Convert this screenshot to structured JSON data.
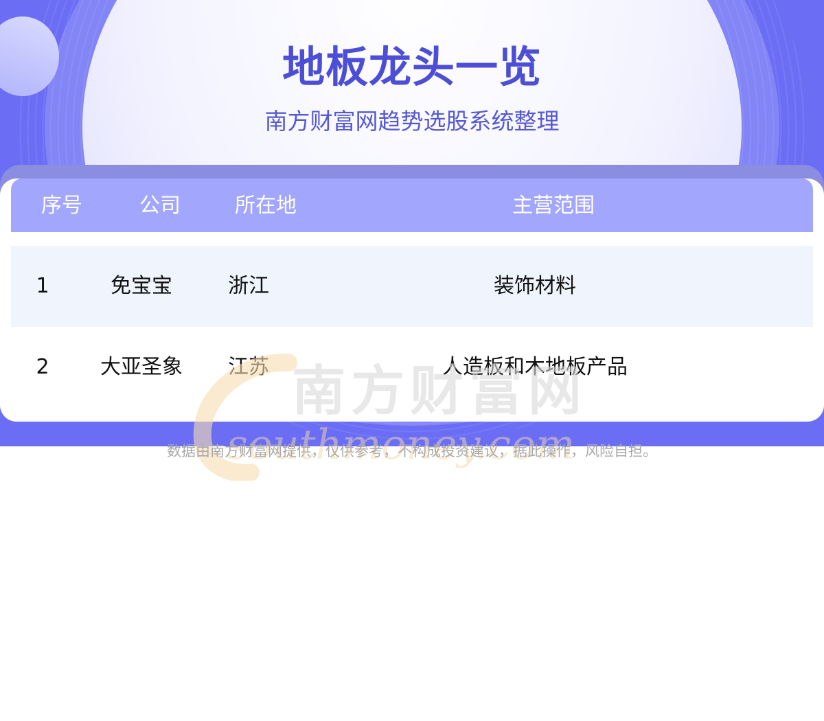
{
  "header": {
    "title": "地板龙头一览",
    "subtitle": "南方财富网趋势选股系统整理"
  },
  "table": {
    "columns": [
      "序号",
      "公司",
      "所在地",
      "主营范围"
    ],
    "rows": [
      [
        "1",
        "免宝宝",
        "浙江",
        "装饰材料"
      ],
      [
        "2",
        "大亚圣象",
        "江苏",
        "人造板和木地板产品"
      ]
    ]
  },
  "watermark": {
    "name": "南方财富网",
    "domain": "southmoney.com"
  },
  "footer": {
    "disclaimer": "数据由南方财富网提供，仅供参考，不构成投资建议，据此操作，风险自担。"
  },
  "colors": {
    "banner": "#6b6ef5",
    "title": "#4c4fd6",
    "table_header": "#a2a6fd",
    "row_shade": "#eff4fd",
    "disclaimer": "#a9a9a9"
  },
  "icons": [
    "southmoney-logo-watermark"
  ]
}
